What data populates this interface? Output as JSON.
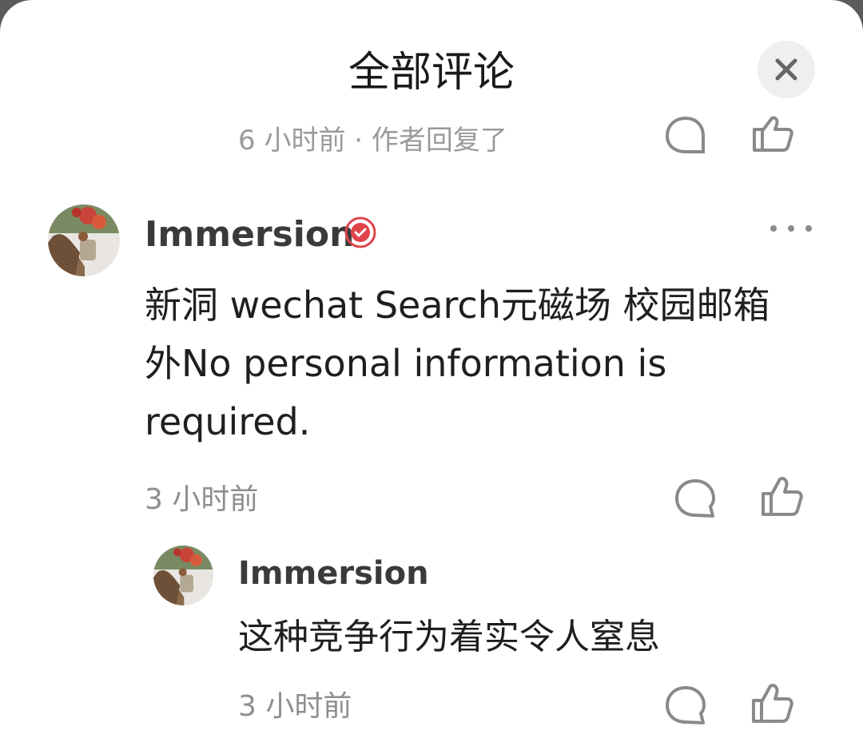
{
  "header": {
    "title": "全部评论"
  },
  "previous_comment": {
    "meta": "6 小时前 · 作者回复了"
  },
  "comments": [
    {
      "user": "Immersion",
      "verified": true,
      "text": "新洞 wechat Search元磁场 校园邮箱 外No personal information is required.",
      "time": "3 小时前",
      "replies": [
        {
          "user": "Immersion",
          "text": "这种竞争行为着实令人窒息",
          "time": "3 小时前"
        }
      ]
    }
  ],
  "icons": {
    "close": "close-icon",
    "reply": "speech-bubble-icon",
    "like": "thumbs-up-icon",
    "more": "more-dots-icon",
    "verified": "verified-badge-icon"
  },
  "colors": {
    "verified_badge": "#e0444b",
    "timestamp": "#8e8e8e",
    "icon_stroke": "#8a8a8a"
  }
}
